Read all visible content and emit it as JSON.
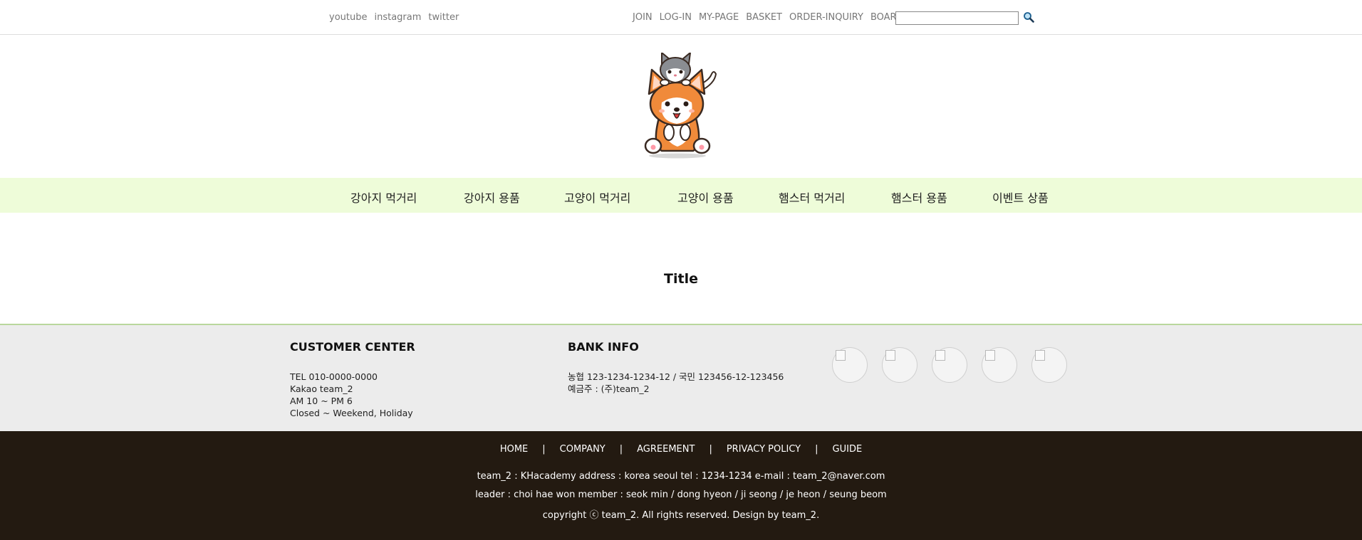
{
  "topbar": {
    "social": [
      "youtube",
      "instagram",
      "twitter"
    ],
    "menu": [
      "JOIN",
      "LOG-IN",
      "MY-PAGE",
      "BASKET",
      "ORDER-INQUIRY",
      "BOARD"
    ],
    "search_placeholder": ""
  },
  "categories": [
    "강아지 먹거리",
    "강아지 용품",
    "고양이 먹거리",
    "고양이 용품",
    "햄스터 먹거리",
    "햄스터 용품",
    "이벤트 상품"
  ],
  "main": {
    "title": "Title"
  },
  "customer_center": {
    "heading": "CUSTOMER CENTER",
    "tel": "TEL 010-0000-0000",
    "kakao": "Kakao team_2",
    "hours": "AM 10 ~ PM 6",
    "closed": "Closed ~ Weekend, Holiday"
  },
  "bank_info": {
    "heading": "BANK INFO",
    "accounts": "농협 123-1234-1234-12 / 국민 123456-12-123456",
    "holder": "예금주 : (주)team_2"
  },
  "footer": {
    "links": [
      "HOME",
      "COMPANY",
      "AGREEMENT",
      "PRIVACY POLICY",
      "GUIDE"
    ],
    "separator": "|",
    "company_line": "team_2 : KHacademy address : korea seoul tel : 1234-1234 e-mail : team_2@naver.com",
    "members_line": "leader : choi hae won member : seok min / dong hyeon / ji seong / je heon / seung beom",
    "copyright": "copyright ⓒ team_2. All rights reserved. Design by team_2."
  },
  "colors": {
    "nav_bg": "#eefcd9",
    "info_bg": "#ececec",
    "info_border": "#b9d79d",
    "footer_bg": "#231a11",
    "link_gray": "#777777"
  }
}
